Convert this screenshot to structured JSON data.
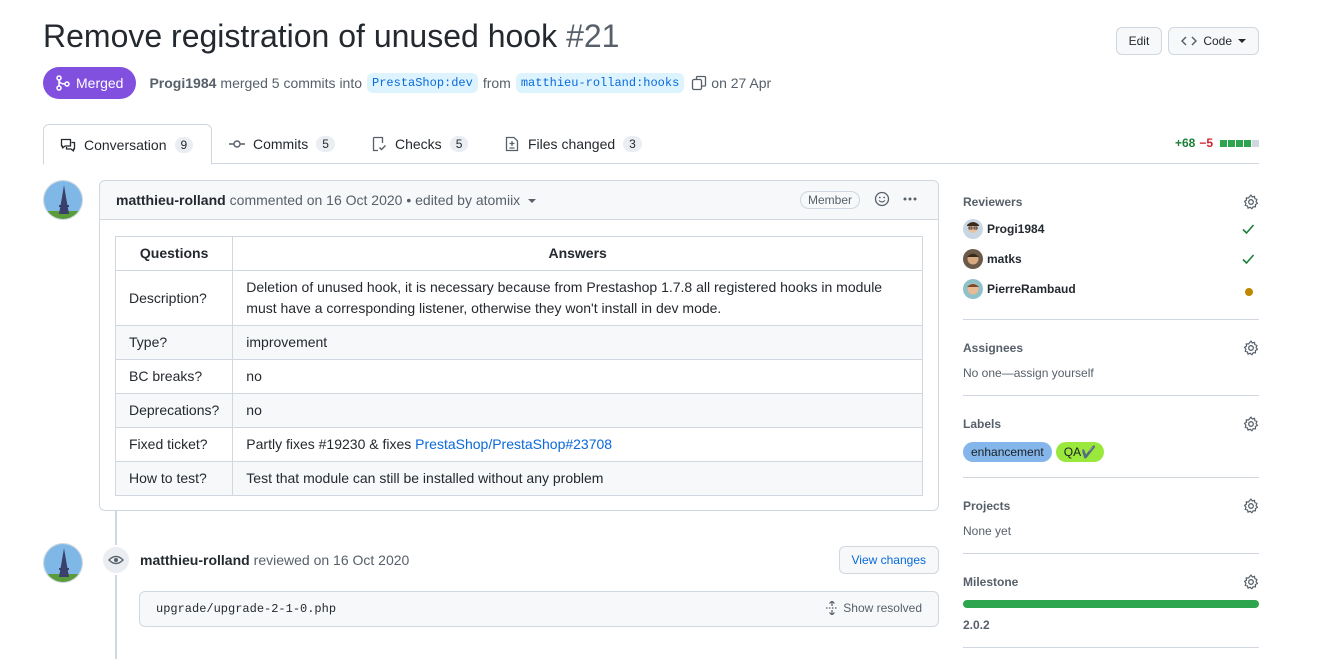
{
  "header": {
    "title": "Remove registration of unused hook",
    "number": "#21",
    "edit_label": "Edit",
    "code_label": "Code"
  },
  "meta": {
    "state": "Merged",
    "author": "Progi1984",
    "action_text": "merged 5 commits into",
    "base_branch": "PrestaShop:dev",
    "from_text": "from",
    "head_branch": "matthieu-rolland:hooks",
    "date_text": "on 27 Apr"
  },
  "tabs": [
    {
      "label": "Conversation",
      "count": "9"
    },
    {
      "label": "Commits",
      "count": "5"
    },
    {
      "label": "Checks",
      "count": "5"
    },
    {
      "label": "Files changed",
      "count": "3"
    }
  ],
  "diffstat": {
    "additions": "+68",
    "deletions": "−5",
    "blocks": [
      "add",
      "add",
      "add",
      "add",
      "neutral"
    ],
    "colors": {
      "add": "#2da44e",
      "del": "#cf222e",
      "neutral": "#d0d7de"
    }
  },
  "comment": {
    "author": "matthieu-rolland",
    "meta_text": "commented on 16 Oct 2020 • edited by atomiix",
    "role": "Member",
    "table": {
      "headers": [
        "Questions",
        "Answers"
      ],
      "rows": [
        {
          "q": "Description?",
          "a": "Deletion of unused hook, it is necessary because from Prestashop 1.7.8 all registered hooks in module must have a corresponding listener, otherwise they won't install in dev mode."
        },
        {
          "q": "Type?",
          "a": "improvement"
        },
        {
          "q": "BC breaks?",
          "a": "no"
        },
        {
          "q": "Deprecations?",
          "a": "no"
        },
        {
          "q": "Fixed ticket?",
          "a": "Partly fixes #19230 & fixes ",
          "link": "PrestaShop/PrestaShop#23708"
        },
        {
          "q": "How to test?",
          "a": "Test that module can still be installed without any problem"
        }
      ]
    }
  },
  "review": {
    "author": "matthieu-rolland",
    "text": "reviewed on 16 Oct 2020",
    "view_changes": "View changes",
    "file": "upgrade/upgrade-2-1-0.php",
    "show_resolved": "Show resolved"
  },
  "sidebar": {
    "reviewers_title": "Reviewers",
    "reviewers": [
      {
        "name": "Progi1984",
        "status": "approved"
      },
      {
        "name": "matks",
        "status": "approved"
      },
      {
        "name": "PierreRambaud",
        "status": "pending"
      }
    ],
    "assignees_title": "Assignees",
    "assignees_text": "No one—assign yourself",
    "labels_title": "Labels",
    "labels": [
      {
        "name": "enhancement",
        "bg": "#84b6eb",
        "fg": "#1b1f23"
      },
      {
        "name": "QA✔️",
        "bg": "#9be83d",
        "fg": "#1b1f23"
      }
    ],
    "projects_title": "Projects",
    "projects_text": "None yet",
    "milestone_title": "Milestone",
    "milestone_name": "2.0.2",
    "milestone_progress": 1.0
  }
}
